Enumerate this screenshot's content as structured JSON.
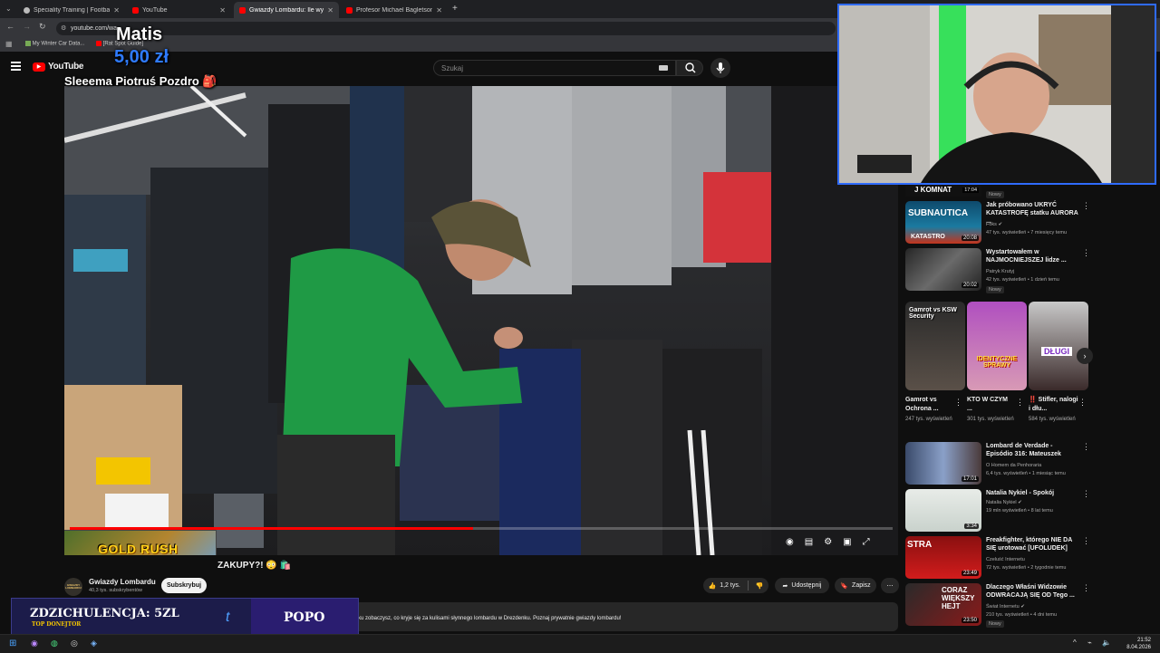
{
  "browser": {
    "tabs": [
      {
        "label": "Speciality Training | FootballTea",
        "active": false
      },
      {
        "label": "YouTube",
        "active": false
      },
      {
        "label": "Gwiazdy Lombardu: Ile wyd...",
        "active": true
      },
      {
        "label": "Profesor Michael Bagletson - ...",
        "active": false
      }
    ],
    "url": "youtube.com/wa",
    "bookmarks": [
      "My Winter Car Data...",
      "[Rat Spot Guide]"
    ]
  },
  "youtube": {
    "logo": "YouTube",
    "search_placeholder": "Szukaj"
  },
  "donation": {
    "name": "Matis",
    "amount": "5,00 zł",
    "message": "Sleeema Piotruś Pozdro 🎒"
  },
  "video": {
    "title_fragment": "ZAKUPY?! 😳 🛍️",
    "progress": 0.49,
    "promo_banner": "GOLD RUSH"
  },
  "channel": {
    "name": "Gwiazdy Lombardu",
    "avatar_text": "GWIAZDY LOMBARDU",
    "subscribers": "40,3 tys. subskrybentów",
    "subscribe_label": "Subskrybuj"
  },
  "actions": {
    "likes": "1,2 tys.",
    "share": "Udostępnij",
    "save": "Zapisz"
  },
  "description": "ku zobaczysz, co kryje się za kulisami słynnego lombardu w Drezdenku. Poznaj prywatnie gwiazdy lombardu!",
  "overlay_bar": {
    "top_donator_label": "ZDZICHULENCJA: 5ZL",
    "top_donator_sub": "TOP DONEJTOR",
    "right_label": "POPO"
  },
  "sidebar": {
    "partial_header": "J KOMNAT",
    "partial_duration": "17:04",
    "partial_badge": "Nowy",
    "videos": [
      {
        "title": "Jak próbowano UKRYĆ KATASTROFĘ statku AURORA ...",
        "channel": "Foks ✔",
        "meta": "47 tys. wyświetleń • 7 miesięcy temu",
        "duration": "20:08",
        "thumb_text": "SUBNAUTICA",
        "thumb_sub": "KATASTRO",
        "badge": ""
      },
      {
        "title": "Wystartowałem w NAJMOCNIEJSZEJ lidze ...",
        "channel": "Patryk Krutyj",
        "meta": "42 tys. wyświetleń • 1 dzień temu",
        "duration": "20:02",
        "thumb_text": "",
        "thumb_sub": "",
        "badge": "Nowy"
      },
      {
        "title": "Lombard de Verdade - Episódio 316: Mateuszek",
        "channel": "O Homem da Penhoraria",
        "meta": "6,4 tys. wyświetleń • 1 miesiąc temu",
        "duration": "17:01",
        "thumb_text": "",
        "thumb_sub": "",
        "badge": ""
      },
      {
        "title": "Natalia Nykiel - Spokój",
        "channel": "Natalia Nykiel ✔",
        "meta": "19 mln wyświetleń • 8 lat temu",
        "duration": "3:34",
        "thumb_text": "",
        "thumb_sub": "",
        "badge": ""
      },
      {
        "title": "Freakfighter, którego NIE DA SIĘ urotować [UFOLUDEK]",
        "channel": "Czeluść Internetu",
        "meta": "72 tys. wyświetleń • 2 tygodnie temu",
        "duration": "23:49",
        "thumb_text": "STRA",
        "thumb_sub": "",
        "badge": ""
      },
      {
        "title": "Dlaczego Właśni Widzowie ODWRACAJĄ SIĘ OD Tego ...",
        "channel": "Świat Internetu ✔",
        "meta": "210 tys. wyświetleń • 4 dni temu",
        "duration": "23:50",
        "thumb_text": "CORAZ WIĘKSZY HEJT",
        "thumb_sub": "",
        "badge": "Nowy"
      }
    ],
    "shorts": [
      {
        "title": "Gamrot vs Ochrona ...",
        "views": "247 tys. wyświetleń",
        "thumb_text": "Gamrot vs KSW Security"
      },
      {
        "title": "KTO W CZYM ...",
        "views": "301 tys. wyświetleń",
        "thumb_text": "IDENTYCZNE SPRAWY"
      },
      {
        "title": "‼️ Stifler, nalogi i dłu...",
        "views": "584 tys. wyświetleń",
        "thumb_text": "DŁUGI"
      }
    ]
  },
  "taskbar": {
    "time": "21:52",
    "date": "8.04.2026"
  },
  "colors": {
    "yt_red": "#ff0000",
    "subscribe_bg": "#f1f1f1",
    "overlay_bar_bg": "#1c1c4a",
    "overlay_bar_right": "#2a1d70"
  }
}
